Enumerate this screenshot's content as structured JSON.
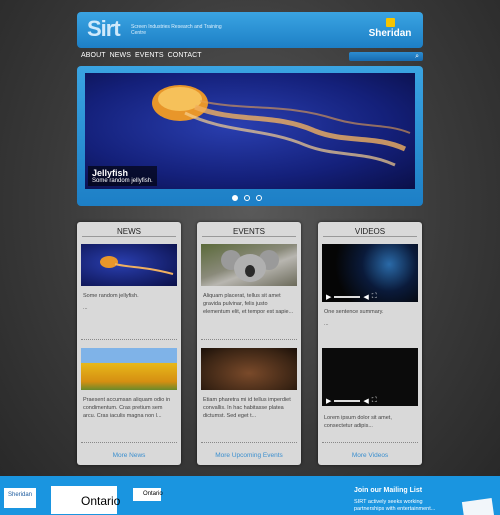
{
  "header": {
    "logo": "Sirt",
    "subtitle": "Screen Industries Research and Training Centre",
    "partner_logo": "Sheridan"
  },
  "nav": [
    "ABOUT",
    "NEWS",
    "EVENTS",
    "CONTACT"
  ],
  "search": {
    "icon": "search-icon"
  },
  "slider": {
    "caption_title": "Jellyfish",
    "caption_text": "Some random jellyfish.",
    "dots": 3,
    "active_dot": 0
  },
  "news": {
    "title": "NEWS",
    "item1_text": "Some random jellyfish.",
    "item1_ellipsis": "...",
    "item2_text": "Praesent accumsan aliquam odio in condimentum. Cras pretium sem arcu. Cras iaculis magna non l...",
    "more": "More News"
  },
  "events": {
    "title": "EVENTS",
    "item1_text": "Aliquam placerat, tellus sit amet gravida pulvinar, felis justo elementum elit, et tempor est sapie...",
    "item2_text": "Etiam pharetra mi id tellus imperdiet convallis. In hac habitasse platea dictumst. Sed eget t...",
    "more": "More Upcoming Events"
  },
  "videos": {
    "title": "VIDEOS",
    "item1_text": "One sentence summary.",
    "item1_ellipsis": "...",
    "item2_text": "Lorem ipsum dolor sit amet, consectetur adipis...",
    "more": "More Videos"
  },
  "footer": {
    "logo1": "Sheridan",
    "logo2": "Ontario",
    "logo3": "Ontario",
    "mailing_title": "Join our Mailing List",
    "mailing_text": "SIRT actively seeks working partnerships with entertainment..."
  }
}
